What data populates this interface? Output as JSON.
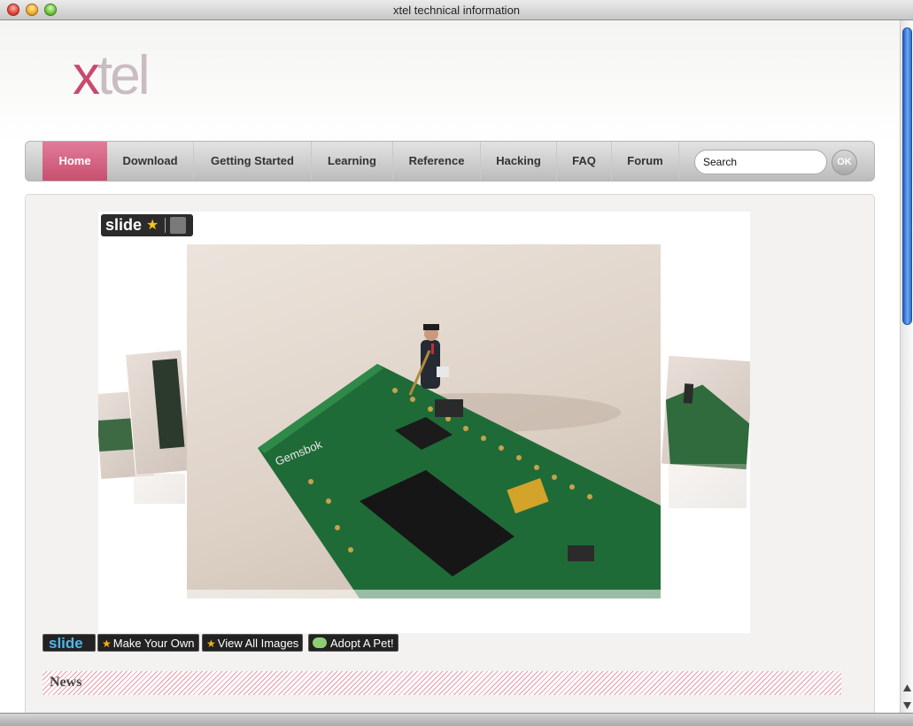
{
  "window": {
    "title": "xtel technical information"
  },
  "logo": {
    "first": "x",
    "rest": "tel"
  },
  "nav": {
    "items": [
      "Home",
      "Download",
      "Getting Started",
      "Learning",
      "Reference",
      "Hacking",
      "FAQ",
      "Forum"
    ],
    "active": "Home"
  },
  "search": {
    "value": "Search",
    "button_label": "OK"
  },
  "slideshow": {
    "badge_text": "slide",
    "board_label": "Gemsbok"
  },
  "buttons": {
    "slide_label": "slide",
    "make_your_own": "Make Your Own",
    "view_all_images": "View All Images",
    "adopt_a_pet": "Adopt A Pet!"
  },
  "news": {
    "title": "News"
  },
  "colors": {
    "accent": "#c84a6e",
    "nav_active": "#d3607f"
  }
}
